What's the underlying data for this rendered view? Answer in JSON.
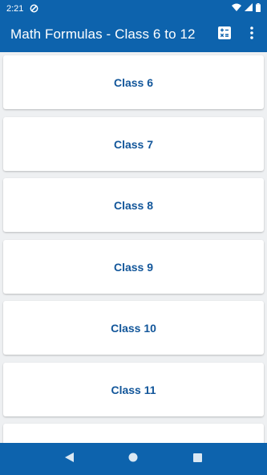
{
  "status_bar": {
    "time": "2:21",
    "icons": [
      "data-saver-icon",
      "wifi-icon",
      "signal-icon",
      "battery-icon"
    ]
  },
  "app_bar": {
    "title": "Math Formulas - Class 6 to 12",
    "actions": [
      "calculator-icon",
      "more-vert-icon"
    ]
  },
  "classes": [
    {
      "label": "Class 6"
    },
    {
      "label": "Class 7"
    },
    {
      "label": "Class 8"
    },
    {
      "label": "Class 9"
    },
    {
      "label": "Class 10"
    },
    {
      "label": "Class 11"
    },
    {
      "label": ""
    }
  ],
  "nav_bar": {
    "buttons": [
      "back-icon",
      "home-icon",
      "recents-icon"
    ]
  },
  "colors": {
    "primary": "#0d63ad",
    "label": "#12569a",
    "background": "#eef0f2"
  }
}
